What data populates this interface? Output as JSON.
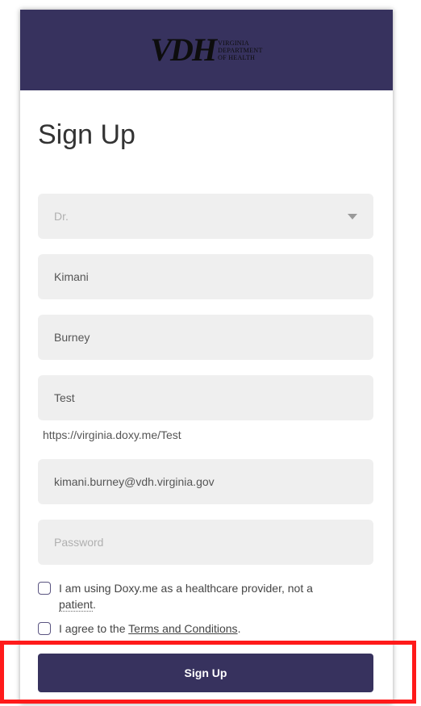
{
  "header": {
    "logo_mark": "VDH",
    "logo_lines": [
      "VIRGINIA",
      "DEPARTMENT",
      "OF HEALTH"
    ]
  },
  "form": {
    "title": "Sign Up",
    "title_select": {
      "value": "Dr."
    },
    "first_name": {
      "value": "Kimani"
    },
    "last_name": {
      "value": "Burney"
    },
    "room_name": {
      "value": "Test"
    },
    "room_url": "https://virginia.doxy.me/Test",
    "email": {
      "value": "kimani.burney@vdh.virginia.gov"
    },
    "password": {
      "placeholder": "Password"
    },
    "provider_check": {
      "text_before": "I am using Doxy.me as a healthcare provider, not a",
      "underlined": "patient",
      "text_after": "."
    },
    "terms_check": {
      "text_before": "I agree to the",
      "link": "Terms and Conditions",
      "text_after": "."
    },
    "submit_label": "Sign Up"
  },
  "colors": {
    "brand": "#37325e",
    "highlight": "#ff1a1a"
  }
}
